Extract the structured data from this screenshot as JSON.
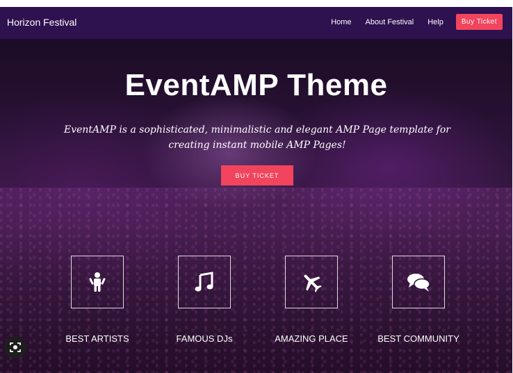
{
  "navbar": {
    "brand": "Horizon Festival",
    "links": [
      "Home",
      "About Festival",
      "Help"
    ],
    "cta": "Buy Ticket"
  },
  "hero": {
    "title": "EventAMP Theme",
    "subtitle": "EventAMP is a sophisticated, minimalistic and elegant AMP Page template for creating instant mobile AMP Pages!",
    "cta": "BUY TICKET"
  },
  "features": [
    {
      "label": "BEST ARTISTS",
      "icon": "child-icon"
    },
    {
      "label": "FAMOUS DJs",
      "icon": "music-note-icon"
    },
    {
      "label": "AMAZING PLACE",
      "icon": "airplane-icon"
    },
    {
      "label": "BEST COMMUNITY",
      "icon": "chat-bubbles-icon"
    }
  ],
  "colors": {
    "navbar": "#2e114f",
    "accent": "#f2455d",
    "text": "#ffffff"
  }
}
